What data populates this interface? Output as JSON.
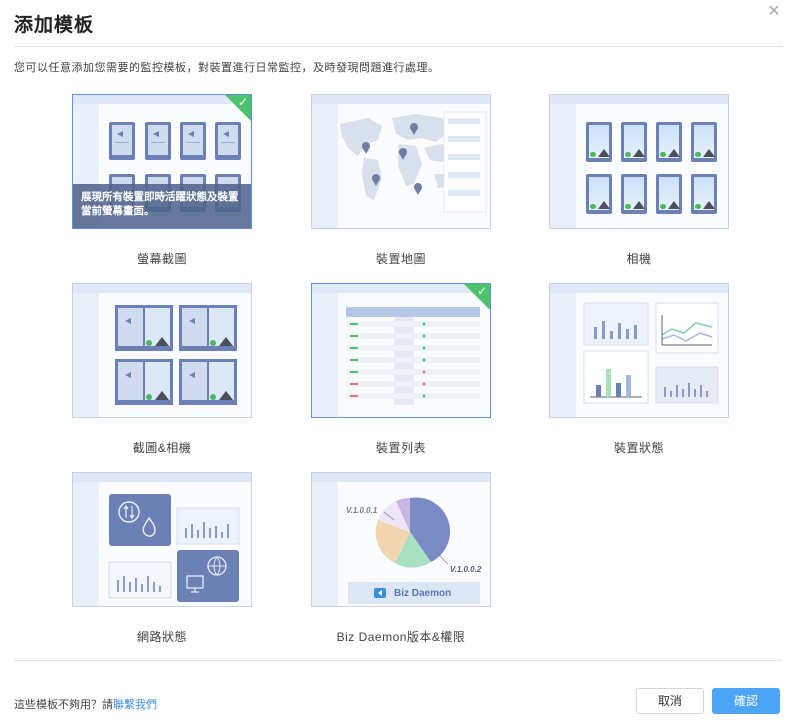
{
  "dialog": {
    "title": "添加模板",
    "description": "您可以任意添加您需要的監控模板，對裝置進行日常監控，及時發現問題進行處理。"
  },
  "templates": [
    {
      "label": "螢幕截圖",
      "selected": true,
      "overlay": "展現所有裝置即時活躍狀態及裝置當前螢幕畫面。"
    },
    {
      "label": "裝置地圖",
      "selected": false
    },
    {
      "label": "相機",
      "selected": false
    },
    {
      "label": "截圖&相機",
      "selected": false
    },
    {
      "label": "裝置列表",
      "selected": true
    },
    {
      "label": "裝置狀態",
      "selected": false
    },
    {
      "label": "網路狀態",
      "selected": false
    },
    {
      "label": "Biz Daemon版本&權限",
      "selected": false
    }
  ],
  "pie_preview": {
    "version_a": "V.1.0.0.1",
    "version_b": "V.1.0.0.2",
    "brand": "Biz Daemon"
  },
  "footer": {
    "prompt": "這些模板不夠用？請",
    "contact_link": "聯繫我們",
    "cancel_label": "取消",
    "confirm_label": "確認"
  },
  "colors": {
    "accent": "#4ca4f5",
    "check": "#4cc36b",
    "link": "#3b8ee5",
    "selected_border": "#5b95de"
  },
  "icons": {
    "close": "close-icon",
    "check": "check-icon"
  }
}
